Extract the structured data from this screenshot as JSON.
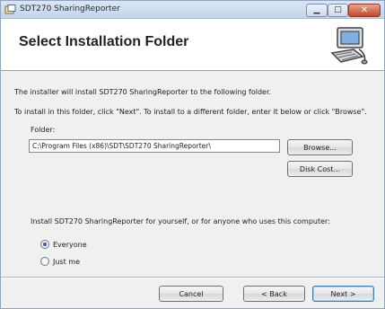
{
  "window": {
    "title": "SDT270 SharingReporter",
    "controls": {
      "minimize_icon": "minimize-icon",
      "maximize_icon": "maximize-icon",
      "close_icon": "close-icon"
    }
  },
  "banner": {
    "title": "Select Installation Folder",
    "art_icon": "computer-setup-icon"
  },
  "content": {
    "line1": "The installer will install SDT270 SharingReporter to the following folder.",
    "line2": "To install in this folder, click \"Next\". To install to a different folder, enter it below or click \"Browse\".",
    "folder_label": "Folder:",
    "folder_value": "C:\\Program Files (x86)\\SDT\\SDT270 SharingReporter\\",
    "browse_label": "Browse...",
    "disk_cost_label": "Disk Cost...",
    "install_for_text": "Install SDT270 SharingReporter for yourself, or for anyone who uses this computer:",
    "radio_everyone": "Everyone",
    "radio_justme": "Just me",
    "selected_option": "Everyone"
  },
  "footer": {
    "cancel_label": "Cancel",
    "back_label": "< Back",
    "next_label": "Next >"
  },
  "colors": {
    "close_button": "#c2472a",
    "titlebar": "#c3d4ea",
    "default_button_border": "#3c7fb1"
  }
}
